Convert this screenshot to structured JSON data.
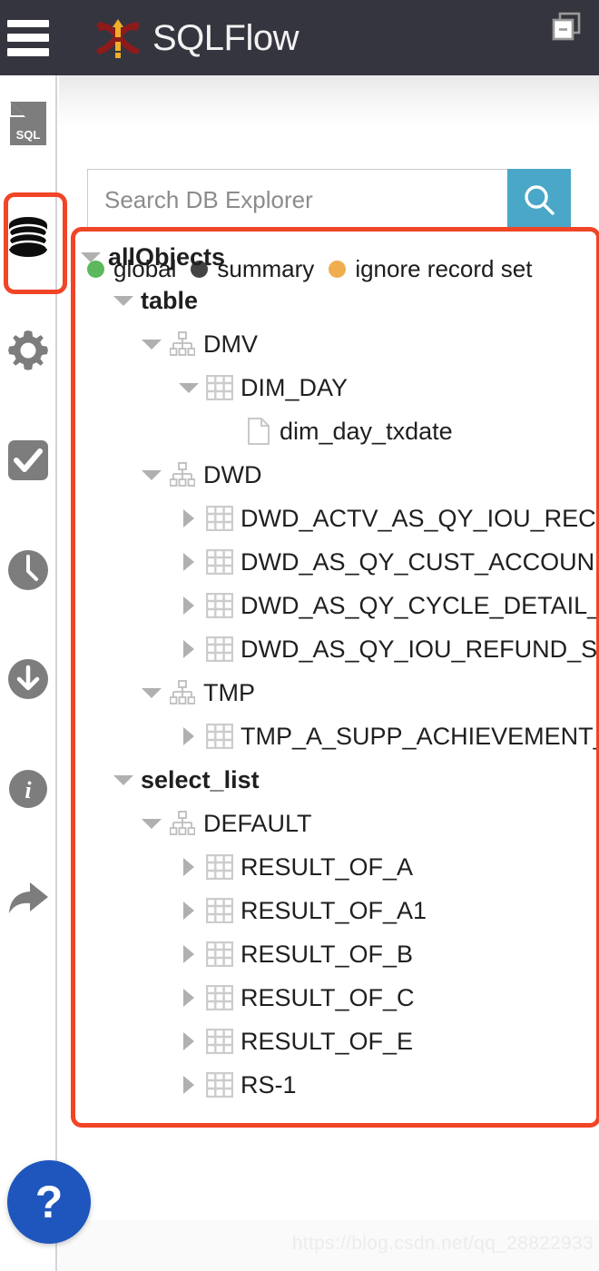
{
  "header": {
    "menu_icon": "hamburger-menu-icon",
    "logo_icon": "sqlflow-logo-icon",
    "brand": "SQLFlow",
    "background_color": "#35353f"
  },
  "rail": {
    "items": [
      {
        "name": "sql-file",
        "icon": "sql-file-icon",
        "label": "SQL"
      },
      {
        "name": "db-explorer",
        "icon": "database-icon",
        "label": "",
        "selected": true
      },
      {
        "name": "settings",
        "icon": "gear-icon",
        "label": ""
      },
      {
        "name": "validate",
        "icon": "check-square-icon",
        "label": ""
      },
      {
        "name": "history",
        "icon": "clock-icon",
        "label": ""
      },
      {
        "name": "download",
        "icon": "download-circle-icon",
        "label": ""
      },
      {
        "name": "info",
        "icon": "info-circle-icon",
        "label": ""
      },
      {
        "name": "share",
        "icon": "share-arrow-icon",
        "label": ""
      }
    ],
    "highlight_color": "#f04526"
  },
  "search": {
    "placeholder": "Search DB Explorer",
    "value": "",
    "button_icon": "search-icon",
    "button_color": "#4ba7c7"
  },
  "legend": {
    "items": [
      {
        "label": "global",
        "color": "#5cb85c"
      },
      {
        "label": "summary",
        "color": "#444444"
      },
      {
        "label": "ignore record set",
        "color": "#f0ad4e"
      }
    ]
  },
  "tree": {
    "collapse_all_icon": "collapse-all-icon",
    "nodes": [
      {
        "level": 0,
        "label": "allObjects",
        "icon": "none",
        "caret": "down",
        "bold": true
      },
      {
        "level": 1,
        "label": "table",
        "icon": "none",
        "caret": "down",
        "bold": true
      },
      {
        "level": 2,
        "label": "DMV",
        "icon": "schema-icon",
        "caret": "down",
        "bold": false
      },
      {
        "level": 3,
        "label": "DIM_DAY",
        "icon": "table-icon",
        "caret": "down",
        "bold": false
      },
      {
        "level": 4,
        "label": "dim_day_txdate",
        "icon": "column-icon",
        "caret": "none",
        "bold": false
      },
      {
        "level": 2,
        "label": "DWD",
        "icon": "schema-icon",
        "caret": "down",
        "bold": false
      },
      {
        "level": 3,
        "label": "DWD_ACTV_AS_QY_IOU_REC",
        "icon": "table-icon",
        "caret": "right",
        "bold": false
      },
      {
        "level": 3,
        "label": "DWD_AS_QY_CUST_ACCOUN",
        "icon": "table-icon",
        "caret": "right",
        "bold": false
      },
      {
        "level": 3,
        "label": "DWD_AS_QY_CYCLE_DETAIL_",
        "icon": "table-icon",
        "caret": "right",
        "bold": false
      },
      {
        "level": 3,
        "label": "DWD_AS_QY_IOU_REFUND_S",
        "icon": "table-icon",
        "caret": "right",
        "bold": false
      },
      {
        "level": 2,
        "label": "TMP",
        "icon": "schema-icon",
        "caret": "down",
        "bold": false
      },
      {
        "level": 3,
        "label": "TMP_A_SUPP_ACHIEVEMENT_",
        "icon": "table-icon",
        "caret": "right",
        "bold": false
      },
      {
        "level": 1,
        "label": "select_list",
        "icon": "none",
        "caret": "down",
        "bold": true
      },
      {
        "level": 2,
        "label": "DEFAULT",
        "icon": "schema-icon",
        "caret": "down",
        "bold": false
      },
      {
        "level": 3,
        "label": "RESULT_OF_A",
        "icon": "table-icon",
        "caret": "right",
        "bold": false
      },
      {
        "level": 3,
        "label": "RESULT_OF_A1",
        "icon": "table-icon",
        "caret": "right",
        "bold": false
      },
      {
        "level": 3,
        "label": "RESULT_OF_B",
        "icon": "table-icon",
        "caret": "right",
        "bold": false
      },
      {
        "level": 3,
        "label": "RESULT_OF_C",
        "icon": "table-icon",
        "caret": "right",
        "bold": false
      },
      {
        "level": 3,
        "label": "RESULT_OF_E",
        "icon": "table-icon",
        "caret": "right",
        "bold": false
      },
      {
        "level": 3,
        "label": "RS-1",
        "icon": "table-icon",
        "caret": "right",
        "bold": false
      }
    ],
    "highlight_color": "#f04526"
  },
  "help": {
    "label": "?",
    "color": "#1f56bd"
  },
  "watermark": {
    "text": "https://blog.csdn.net/qq_28822933"
  }
}
